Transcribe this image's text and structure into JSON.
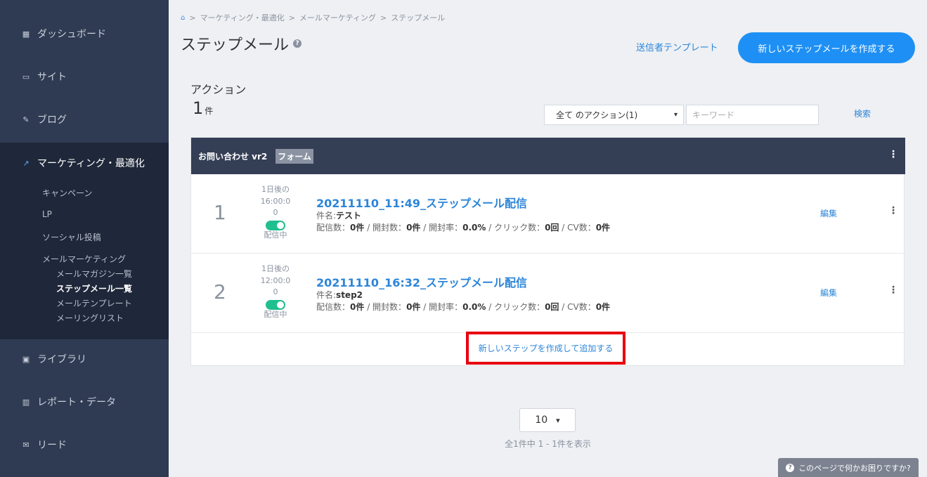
{
  "sidebar": {
    "items": [
      {
        "label": "ダッシュボード",
        "icon": "dashboard-icon"
      },
      {
        "label": "サイト",
        "icon": "site-icon"
      },
      {
        "label": "ブログ",
        "icon": "pencil-icon"
      },
      {
        "label": "マーケティング・最適化",
        "icon": "trend-icon"
      },
      {
        "label": "ライブラリ",
        "icon": "image-icon"
      },
      {
        "label": "レポート・データ",
        "icon": "bar-chart-icon"
      },
      {
        "label": "リード",
        "icon": "mail-icon"
      }
    ],
    "sub_items": [
      "キャンペーン",
      "LP",
      "ソーシャル投稿",
      "メールマーケティング"
    ],
    "mail_sub_items": [
      "メールマガジン一覧",
      "ステップメール一覧",
      "メールテンプレート",
      "メーリングリスト"
    ]
  },
  "breadcrumb": [
    "マーケティング・最適化",
    "メールマーケティング",
    "ステップメール"
  ],
  "breadcrumb_sep": ">",
  "page": {
    "title": "ステップメール",
    "help": "?",
    "template_link": "送信者テンプレート",
    "create_button": "新しいステップメールを作成する"
  },
  "filter": {
    "label": "アクション",
    "count": "1",
    "count_unit": "件",
    "select_value": "全て のアクション(1)",
    "keyword_placeholder": "キーワード",
    "search_link": "検索"
  },
  "card": {
    "header_title": "お問い合わせ vr2",
    "header_badge": "フォーム",
    "rows": [
      {
        "num": "1",
        "timing_line1": "1日後の",
        "timing_line2": "16:00:0",
        "timing_line3": "0",
        "status": "配信中",
        "title": "20211110_11:49_ステップメール配信",
        "subject_label": "件名:",
        "subject": "テスト",
        "stats": {
          "sent_label": "配信数：",
          "sent": "0件",
          "open_label": "開封数：",
          "open": "0件",
          "open_rate_label": "開封率：",
          "open_rate": "0.0%",
          "click_label": "クリック数：",
          "click": "0回",
          "cv_label": "CV数：",
          "cv": "0件"
        },
        "edit": "編集"
      },
      {
        "num": "2",
        "timing_line1": "1日後の",
        "timing_line2": "12:00:0",
        "timing_line3": "0",
        "status": "配信中",
        "title": "20211110_16:32_ステップメール配信",
        "subject_label": "件名:",
        "subject": "step2",
        "stats": {
          "sent_label": "配信数：",
          "sent": "0件",
          "open_label": "開封数：",
          "open": "0件",
          "open_rate_label": "開封率：",
          "open_rate": "0.0%",
          "click_label": "クリック数：",
          "click": "0回",
          "cv_label": "CV数：",
          "cv": "0件"
        },
        "edit": "編集"
      }
    ],
    "add_step": "新しいステップを作成して追加する"
  },
  "pagination": {
    "per_page": "10",
    "info": "全1件中 1 - 1件を表示"
  },
  "help_fab": "このページで何かお困りですか?",
  "colors": {
    "sidebar_bg": "#2f3b52",
    "accent": "#1e90f5",
    "link": "#2d86d9",
    "toggle_on": "#1fbf8f",
    "highlight": "#e8000e"
  }
}
